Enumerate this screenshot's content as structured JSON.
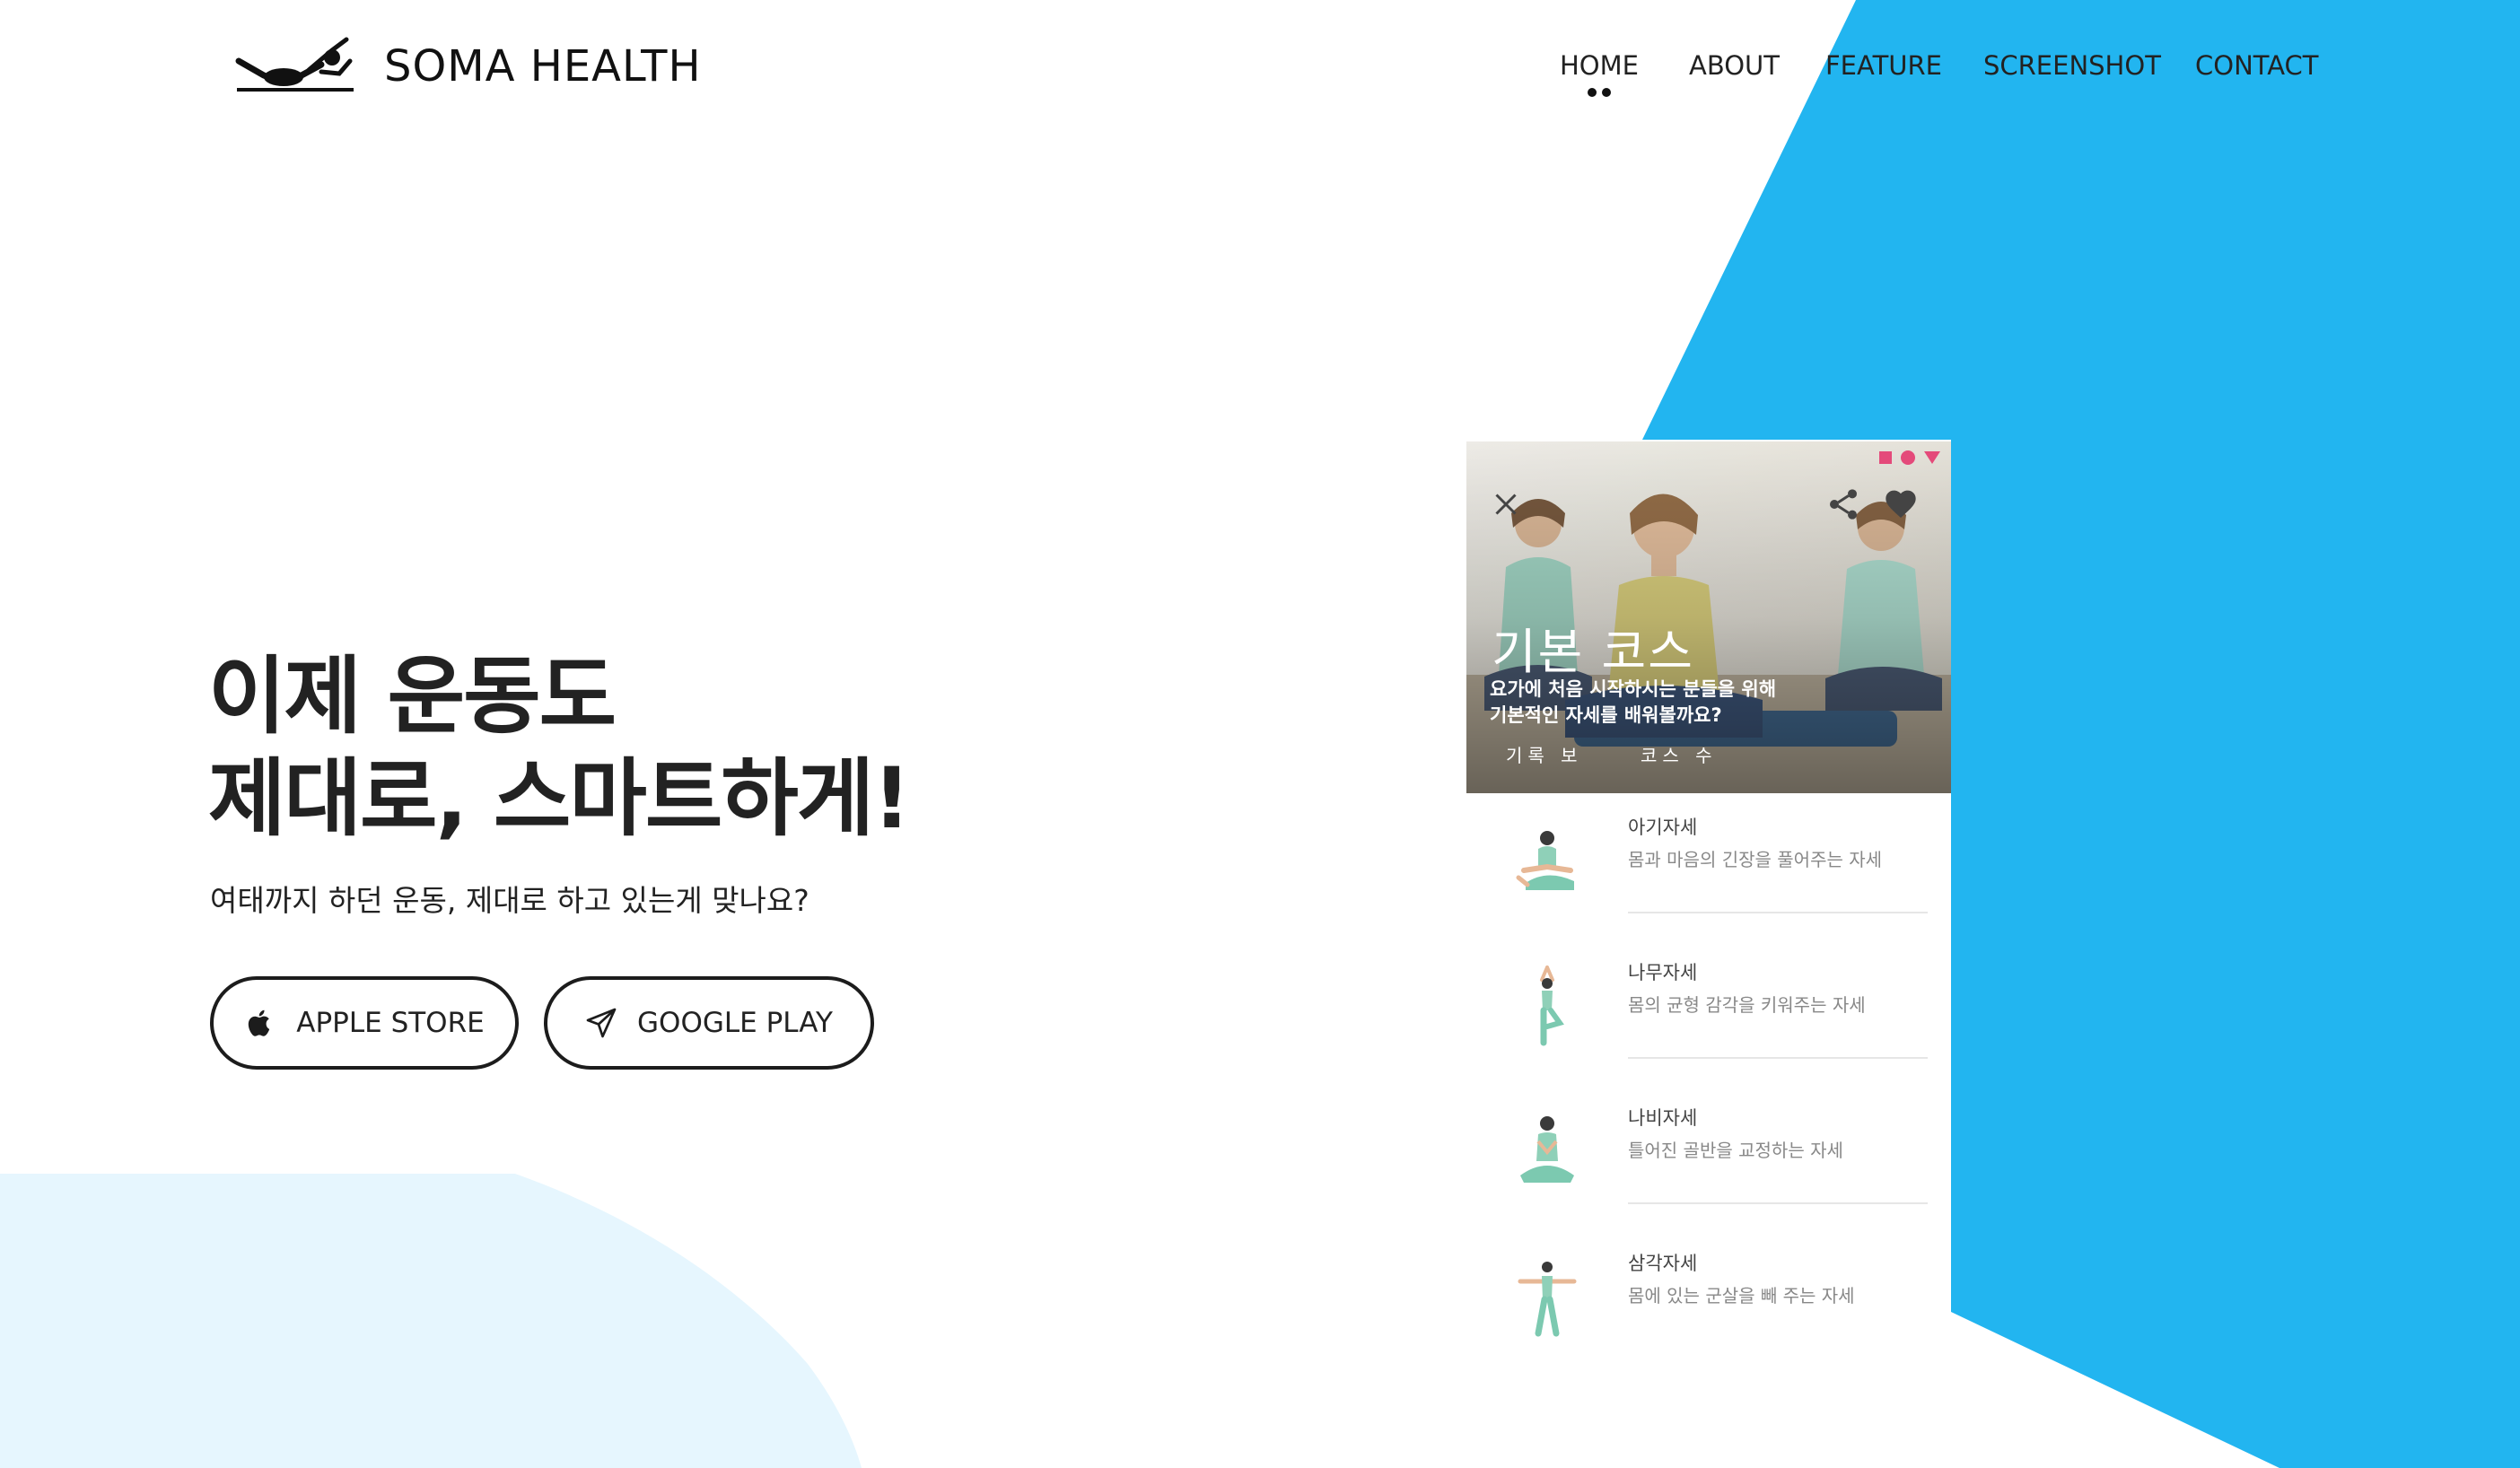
{
  "brand": {
    "name": "SOMA HEALTH",
    "logo_icon": "yoga-pose-icon"
  },
  "nav": {
    "items": [
      {
        "label": "HOME",
        "active": true
      },
      {
        "label": "ABOUT"
      },
      {
        "label": "FEATURE"
      },
      {
        "label": "SCREENSHOT"
      },
      {
        "label": "CONTACT"
      }
    ]
  },
  "hero": {
    "title_line1": "이제 운동도",
    "title_line2": "제대로, 스마트하게!",
    "subtitle": "여태까지 하던 운동, 제대로 하고 있는게 맞나요?",
    "apple_button": {
      "label": "APPLE STORE",
      "icon": "apple-icon"
    },
    "google_button": {
      "label": "GOOGLE PLAY",
      "icon": "paper-plane-icon"
    }
  },
  "phone": {
    "course_title": "기본 코스",
    "course_desc_line1": "요가에 처음 시작하시는 분들을 위해",
    "course_desc_line2": "기본적인 자세를 배워볼까요?",
    "stat_record": "기록 보",
    "stat_courses": "코스 수",
    "status_icons": [
      "square-icon",
      "circle-icon",
      "triangle-icon"
    ],
    "actions": [
      "close-icon",
      "share-icon",
      "heart-icon"
    ],
    "poses": [
      {
        "name": "아기자세",
        "desc": "몸과 마음의 긴장을 풀어주는 자세"
      },
      {
        "name": "나무자세",
        "desc": "몸의 균형 감각을 키워주는 자세"
      },
      {
        "name": "나비자세",
        "desc": "틀어진 골반을 교정하는 자세"
      },
      {
        "name": "삼각자세",
        "desc": "몸에 있는 군살을 빼 주는 자세"
      }
    ],
    "fab_icon": "play-icon"
  },
  "colors": {
    "accent_blue": "#22b5f0",
    "light_blue": "#e6f6fe",
    "fab": "#b3175f",
    "status_pink": "#e44a7a"
  }
}
